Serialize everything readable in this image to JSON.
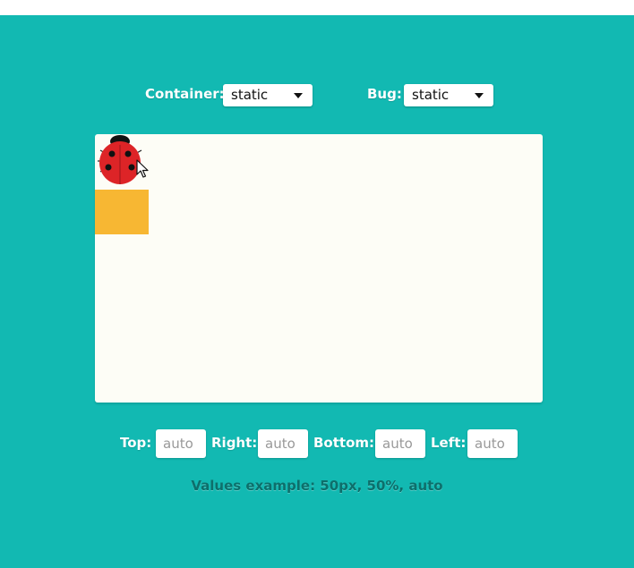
{
  "controls": {
    "container_label": "Container:",
    "container_value": "static",
    "bug_label": "Bug:",
    "bug_value": "static"
  },
  "offsets": {
    "top_label": "Top:",
    "top_placeholder": "auto",
    "right_label": "Right:",
    "right_placeholder": "auto",
    "bottom_label": "Bottom:",
    "bottom_placeholder": "auto",
    "left_label": "Left:",
    "left_placeholder": "auto"
  },
  "hint": "Values example: 50px, 50%, auto",
  "icons": {
    "bug": "ladybug-icon",
    "cursor": "mouse-pointer-icon"
  },
  "colors": {
    "background": "#12b9b2",
    "container": "#fdfdf6",
    "block": "#f7b733",
    "ladybug": "#dd2427"
  }
}
